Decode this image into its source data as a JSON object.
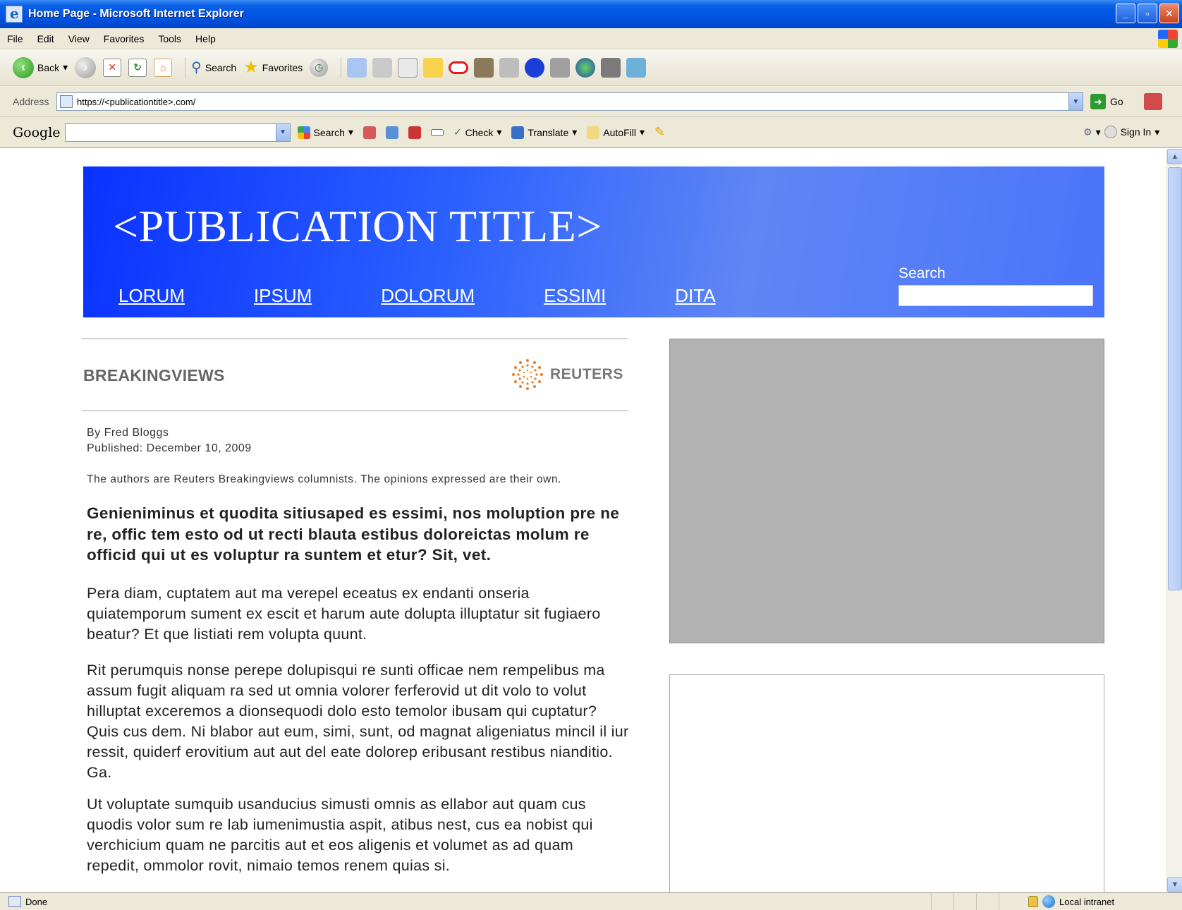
{
  "window": {
    "title": "Home Page - Microsoft Internet Explorer",
    "minimize": "_",
    "maximize": "▫",
    "close": "✕"
  },
  "menu": [
    "File",
    "Edit",
    "View",
    "Favorites",
    "Tools",
    "Help"
  ],
  "toolbar": {
    "back_label": "Back",
    "search_label": "Search",
    "favorites_label": "Favorites"
  },
  "address": {
    "label": "Address",
    "url": "https://<publicationtitle>.com/",
    "go_label": "Go"
  },
  "google_bar": {
    "logo": "Google",
    "search_label": "Search",
    "check_label": "Check",
    "translate_label": "Translate",
    "autofill_label": "AutoFill",
    "signin_label": "Sign In"
  },
  "page": {
    "title": "<PUBLICATION TITLE>",
    "nav": [
      "LORUM",
      "IPSUM",
      "DOLORUM",
      "ESSIMI",
      "DITA"
    ],
    "search_label": "Search",
    "section": "BREAKINGVIEWS",
    "reuters": "REUTERS",
    "byline": "By Fred Bloggs",
    "published": "Published: December 10, 2009",
    "disclaimer": "The authors are Reuters Breakingviews columnists. The opinions expressed are their own.",
    "lede": "Genieniminus et quodita sitiusaped es essimi, nos moluption pre ne re, offic tem esto od ut recti blauta estibus doloreictas molum re officid qui ut es voluptur ra suntem et etur? Sit, vet.",
    "paragraphs": [
      "Pera diam, cuptatem aut ma verepel eceatus ex endanti onseria quiatemporum sument ex escit et harum aute dolupta illuptatur sit fugiaero beatur? Et que listiati rem volupta quunt.",
      "Rit perumquis nonse perepe dolupisqui re sunti officae nem rempelibus ma assum fugit aliquam ra sed ut omnia volorer ferferovid ut dit volo to volut hilluptat exceremos a dionsequodi dolo esto temolor ibusam qui cuptatur? Quis cus dem. Ni blabor aut eum, simi, sunt, od magnat aligeniatus mincil il iur ressit, quiderf erovitium aut aut del eate dolorep eribusant restibus nianditio. Ga.",
      "Ut voluptate sumquib usanducius simusti omnis as ellabor aut quam cus quodis volor sum re lab iumenimustia aspit, atibus nest, cus ea nobist qui verchicium quam ne parcitis aut et eos aligenis et volumet as ad quam repedit, ommolor rovit, nimaio temos renem quias si."
    ]
  },
  "status": {
    "text": "Done",
    "zone": "Local intranet"
  },
  "colors": {
    "masthead_start": "#0a32ff",
    "masthead_end": "#5f86f4",
    "ad_grey": "#b2b2b2",
    "reuters_orange": "#f07a1a"
  }
}
